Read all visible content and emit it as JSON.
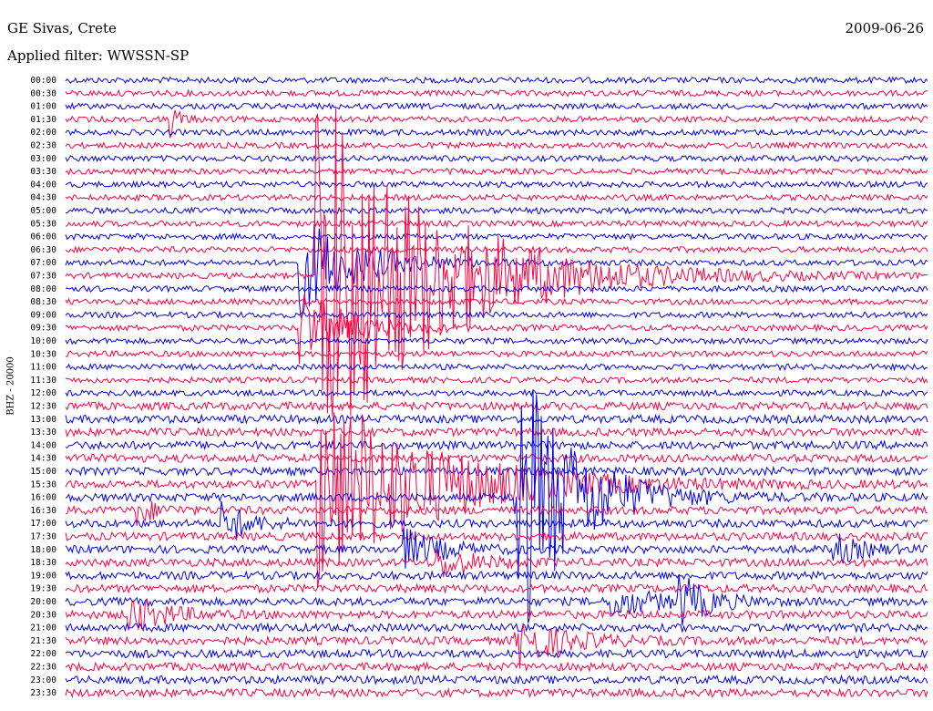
{
  "header": {
    "station": "GE Sivas, Crete",
    "date": "2009-06-26",
    "filter": "Applied filter: WWSSN-SP"
  },
  "chart_data": {
    "type": "line",
    "title": "GE Sivas, Crete",
    "ylabel": "BHZ - 20000",
    "row_labels": [
      "00:00",
      "00:30",
      "01:00",
      "01:30",
      "02:00",
      "02:30",
      "03:00",
      "03:30",
      "04:00",
      "04:30",
      "05:00",
      "05:30",
      "06:00",
      "06:30",
      "07:00",
      "07:30",
      "08:00",
      "08:30",
      "09:00",
      "09:30",
      "10:00",
      "10:30",
      "11:00",
      "11:30",
      "12:00",
      "12:30",
      "13:00",
      "13:30",
      "14:00",
      "14:30",
      "15:00",
      "15:30",
      "16:00",
      "16:30",
      "17:00",
      "17:30",
      "18:00",
      "18:30",
      "19:00",
      "19:30",
      "20:00",
      "20:30",
      "21:00",
      "21:30",
      "22:00",
      "22:30",
      "23:00",
      "23:30"
    ],
    "row_colors": [
      "#0000ee",
      "#ff0040"
    ],
    "events": [
      {
        "row": 3,
        "x_frac": 0.12,
        "amp": 3.5,
        "decay": 0.01
      },
      {
        "row": 14,
        "x_frac": 0.27,
        "amp": 10,
        "decay": 0.06
      },
      {
        "row": 15,
        "x_frac": 0.29,
        "amp": 40,
        "decay": 0.12
      },
      {
        "row": 19,
        "x_frac": 0.27,
        "amp": 8,
        "decay": 0.05
      },
      {
        "row": 31,
        "x_frac": 0.29,
        "amp": 20,
        "decay": 0.12
      },
      {
        "row": 32,
        "x_frac": 0.52,
        "amp": 30,
        "decay": 0.06
      },
      {
        "row": 33,
        "x_frac": 0.08,
        "amp": 3,
        "decay": 0.02
      },
      {
        "row": 34,
        "x_frac": 0.18,
        "amp": 4,
        "decay": 0.03
      },
      {
        "row": 36,
        "x_frac": 0.39,
        "amp": 4,
        "decay": 0.04
      },
      {
        "row": 37,
        "x_frac": 0.43,
        "amp": 3,
        "decay": 0.04
      },
      {
        "row": 36,
        "x_frac": 0.89,
        "amp": 3,
        "decay": 0.03
      },
      {
        "row": 40,
        "x_frac": 0.63,
        "amp": 3,
        "decay": 0.05
      },
      {
        "row": 41,
        "x_frac": 0.07,
        "amp": 4,
        "decay": 0.04
      },
      {
        "row": 40,
        "x_frac": 0.71,
        "amp": 5,
        "decay": 0.03
      },
      {
        "row": 43,
        "x_frac": 0.52,
        "amp": 5,
        "decay": 0.05
      }
    ]
  }
}
